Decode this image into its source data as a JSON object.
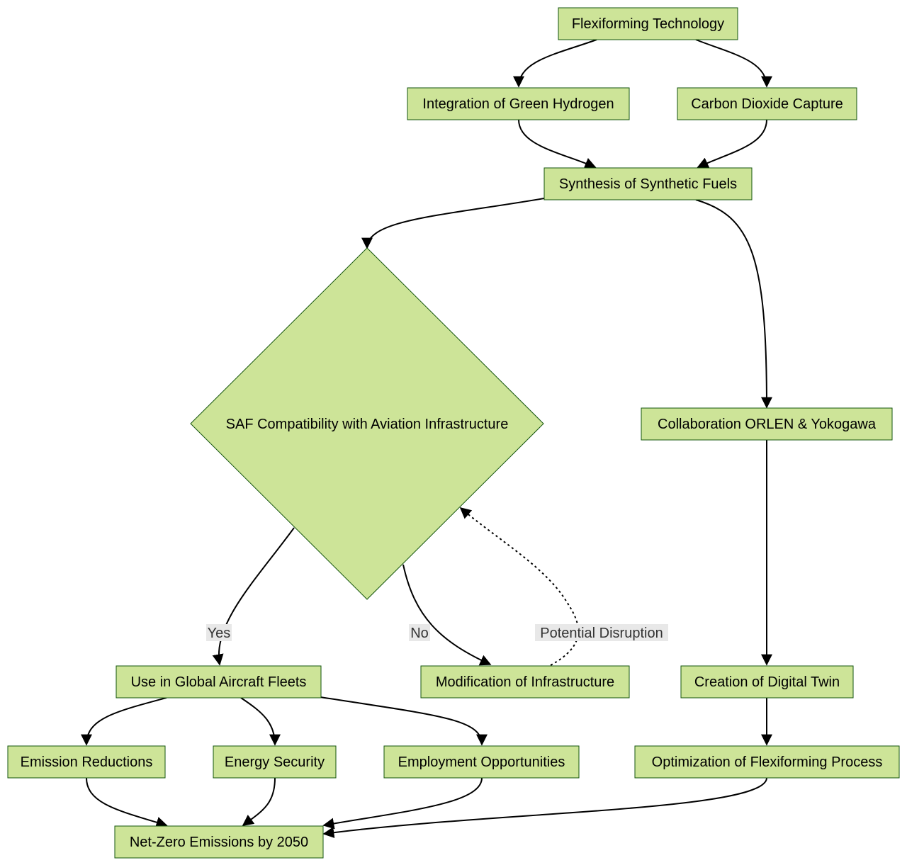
{
  "diagram": {
    "type": "flowchart",
    "nodes": {
      "flex": "Flexiforming Technology",
      "h2": "Integration of Green Hydrogen",
      "co2": "Carbon Dioxide Capture",
      "syn": "Synthesis of Synthetic Fuels",
      "saf": "SAF Compatibility with Aviation Infrastructure",
      "collab": "Collaboration ORLEN & Yokogawa",
      "use": "Use in Global Aircraft Fleets",
      "mod": "Modification of Infrastructure",
      "twin": "Creation of Digital Twin",
      "emis": "Emission Reductions",
      "energy": "Energy Security",
      "employ": "Employment Opportunities",
      "opt": "Optimization of Flexiforming Process",
      "net": "Net-Zero Emissions by 2050"
    },
    "edge_labels": {
      "yes": "Yes",
      "no": "No",
      "disruption": "Potential Disruption"
    },
    "edges": [
      {
        "from": "flex",
        "to": "h2"
      },
      {
        "from": "flex",
        "to": "co2"
      },
      {
        "from": "h2",
        "to": "syn"
      },
      {
        "from": "co2",
        "to": "syn"
      },
      {
        "from": "syn",
        "to": "saf"
      },
      {
        "from": "syn",
        "to": "collab"
      },
      {
        "from": "saf",
        "to": "use",
        "label": "Yes"
      },
      {
        "from": "saf",
        "to": "mod",
        "label": "No"
      },
      {
        "from": "mod",
        "to": "saf",
        "label": "Potential Disruption",
        "style": "dotted"
      },
      {
        "from": "collab",
        "to": "twin"
      },
      {
        "from": "use",
        "to": "emis"
      },
      {
        "from": "use",
        "to": "energy"
      },
      {
        "from": "use",
        "to": "employ"
      },
      {
        "from": "twin",
        "to": "opt"
      },
      {
        "from": "emis",
        "to": "net"
      },
      {
        "from": "energy",
        "to": "net"
      },
      {
        "from": "employ",
        "to": "net"
      },
      {
        "from": "opt",
        "to": "net"
      }
    ],
    "colors": {
      "node_fill": "#cde498",
      "node_stroke": "#13540c",
      "edge": "#000000",
      "label_bg": "#e8e8e8"
    }
  }
}
